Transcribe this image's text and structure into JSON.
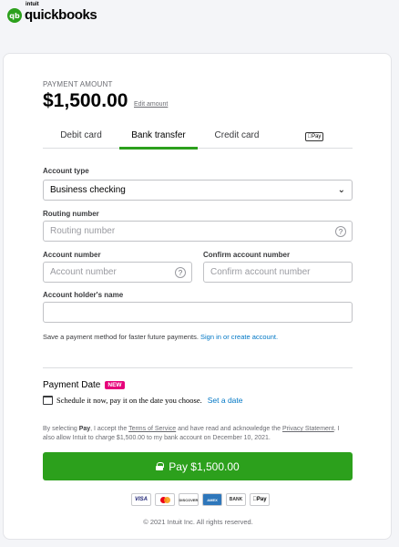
{
  "brand": {
    "intuit": "intuit",
    "name": "quickbooks",
    "mark": "qb"
  },
  "payment": {
    "label": "PAYMENT AMOUNT",
    "amount": "$1,500.00",
    "edit_link": "Edit amount"
  },
  "tabs": [
    {
      "label": "Debit card",
      "active": false
    },
    {
      "label": "Bank transfer",
      "active": true
    },
    {
      "label": "Credit card",
      "active": false
    },
    {
      "label": "Pay",
      "active": false
    }
  ],
  "form": {
    "account_type": {
      "label": "Account type",
      "value": "Business checking"
    },
    "routing": {
      "label": "Routing number",
      "placeholder": "Routing number"
    },
    "account_number": {
      "label": "Account number",
      "placeholder": "Account number"
    },
    "confirm_account": {
      "label": "Confirm account number",
      "placeholder": "Confirm account number"
    },
    "holder_name": {
      "label": "Account holder's name",
      "value": ""
    }
  },
  "save_note": {
    "text": "Save a payment method for faster future payments.",
    "link": "Sign in or create account."
  },
  "payment_date": {
    "title": "Payment Date",
    "badge": "NEW",
    "schedule_text": "Schedule it now, pay it on the date you choose.",
    "schedule_link": "Set a date"
  },
  "terms": {
    "p1": "By selecting ",
    "pay_word": "Pay",
    "p2": ", I accept the ",
    "tos": "Terms of Service",
    "p3": " and have read and acknowledge the ",
    "privacy": "Privacy Statement",
    "p4": ". I also allow Intuit to charge $1,500.00 to my bank account on December 10, 2021."
  },
  "pay_button": {
    "label": "Pay $1,500.00"
  },
  "payment_icons": {
    "visa": "VISA",
    "discover": "DISCOVER",
    "amex": "AMEX",
    "bank": "BANK",
    "applepay": "Pay"
  },
  "colors": {
    "brand_green": "#2ca01c",
    "link_blue": "#0077c5",
    "badge_pink": "#e6007a"
  },
  "footer": {
    "copyright": "© 2021 Intuit Inc. All rights reserved."
  }
}
